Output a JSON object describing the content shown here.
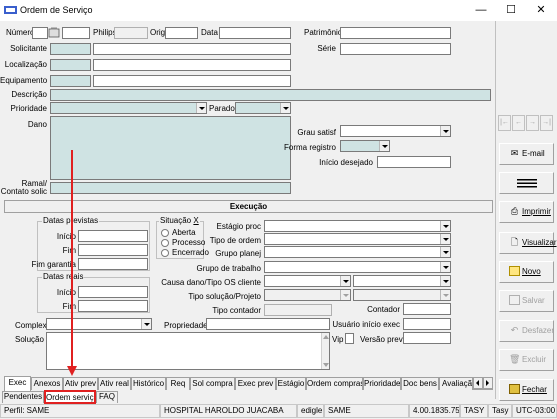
{
  "window": {
    "title": "Ordem de Serviço",
    "minimize": "—",
    "maximize": "☐",
    "close": "✕"
  },
  "header": {
    "numero_label": "Número",
    "philips_label": "Philips",
    "orig_label": "Orig",
    "data_label": "Data",
    "patrimonio_label": "Patrimônio",
    "serie_label": "Série",
    "solicitante_label": "Solicitante",
    "localizacao_label": "Localização",
    "equipamento_label": "Equipamento",
    "descricao_label": "Descrição",
    "prioridade_label": "Prioridade",
    "parado_label": "Parado",
    "dano_label": "Dano",
    "ramal_label": "Ramal/",
    "contato_label": "Contato solic",
    "grau_satisf_label": "Grau satisf",
    "forma_registro_label": "Forma registro",
    "inicio_desejado_label": "Início desejado"
  },
  "execucao": {
    "header": "Execução",
    "datas_previstas": "Datas previstas",
    "inicio": "Início",
    "fim": "Fim",
    "fim_garantia": "Fim garantia",
    "datas_reais": "Datas reais",
    "inicio_real": "Início",
    "fim_real": "Fim",
    "situacao": "Situação",
    "situacao_x": "X",
    "aberta": "Aberta",
    "processo": "Processo",
    "encerrado": "Encerrado",
    "estagio_proc": "Estágio proc",
    "tipo_ordem": "Tipo de ordem",
    "grupo_planej": "Grupo planej",
    "grupo_trabalho": "Grupo de trabalho",
    "causa_dano": "Causa dano/Tipo OS cliente",
    "tipo_solucao": "Tipo solução/Projeto",
    "tipo_contador": "Tipo contador",
    "contador": "Contador",
    "usuario_inicio": "Usuário início exec",
    "versao_prev": "Versão prev",
    "vip": "Vip",
    "complex": "Complex",
    "propriedade": "Propriedade",
    "solucao": "Solução"
  },
  "right_buttons": [
    {
      "label": "E-mail",
      "icon": "email-icon",
      "enabled": true
    },
    {
      "label": "Imprimir",
      "icon": "printer-icon",
      "enabled": true
    },
    {
      "label": "Visualizar",
      "icon": "preview-icon",
      "enabled": true
    },
    {
      "label": "Novo",
      "icon": "new-icon",
      "enabled": true
    },
    {
      "label": "Salvar",
      "icon": "save-icon",
      "enabled": false
    },
    {
      "label": "Desfazer",
      "icon": "undo-icon",
      "enabled": false
    },
    {
      "label": "Excluir",
      "icon": "delete-icon",
      "enabled": false
    },
    {
      "label": "Fechar",
      "icon": "exit-icon",
      "enabled": true
    }
  ],
  "tabs": [
    "Exec",
    "Anexos",
    "Ativ prev",
    "Ativ real",
    "Histórico",
    "Req",
    "Sol compra",
    "Exec prev",
    "Estágio",
    "Ordem compras",
    "Prioridade",
    "Doc bens",
    "Avaliação"
  ],
  "bottom_tabs": [
    "Pendentes",
    "Ordem serviço",
    "FAQ"
  ],
  "status": {
    "perfil": "Perfil: SAME",
    "hospital": "HOSPITAL HAROLDO JUACABA",
    "user": "edigle",
    "dept": "SAME",
    "version": "4.00.1835.75",
    "app": "TASY",
    "app2": "Tasy",
    "tz": "UTC-03:00"
  },
  "colors": {
    "required_field": "#cfe3e3",
    "window_bg": "#f0f0f0",
    "annotation_red": "#e02020"
  }
}
